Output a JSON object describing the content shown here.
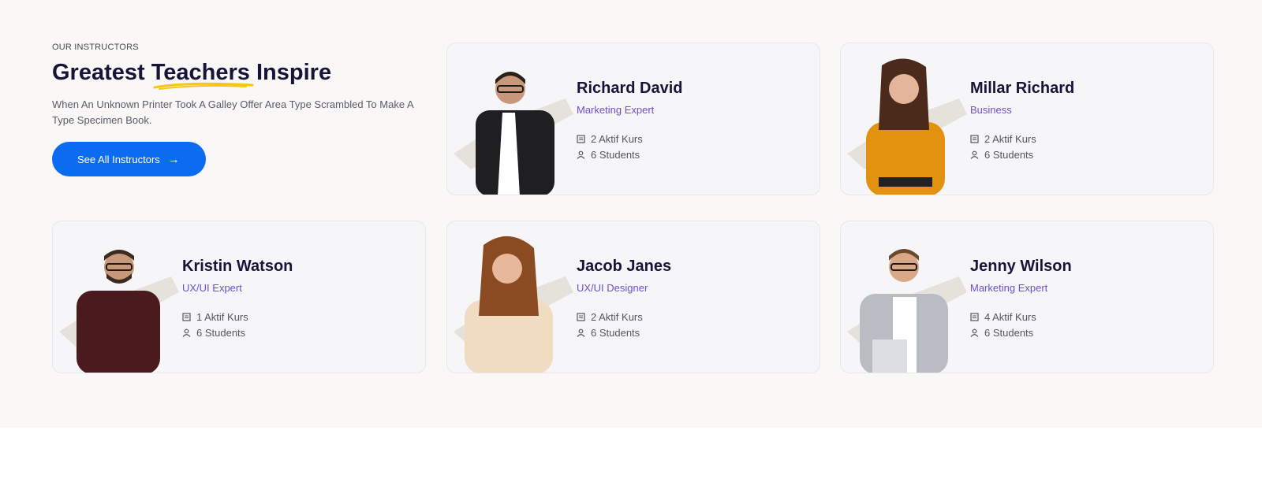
{
  "section": {
    "eyebrow": "OUR INSTRUCTORS",
    "title": "Greatest Teachers Inspire",
    "description": "When An Unknown Printer Took A Galley Offer Area Type Scrambled To Make A Type Specimen Book.",
    "button_label": "See All Instructors",
    "button_icon": "arrow-right-icon"
  },
  "colors": {
    "section_bg": "#f9f8f6",
    "heading": "#161439",
    "role_text": "#6a4fd0",
    "button_bg": "#0b6cf2",
    "underline_accent": "#f5c518"
  },
  "instructors": [
    {
      "name": "Richard David",
      "role": "Marketing Expert",
      "courses": "2 Aktif Kurs",
      "students": "6 Students"
    },
    {
      "name": "Millar Richard",
      "role": "Business",
      "courses": "2 Aktif Kurs",
      "students": "6 Students"
    },
    {
      "name": "Kristin Watson",
      "role": "UX/UI Expert",
      "courses": "1 Aktif Kurs",
      "students": "6 Students"
    },
    {
      "name": "Jacob Janes",
      "role": "UX/UI Designer",
      "courses": "2 Aktif Kurs",
      "students": "6 Students"
    },
    {
      "name": "Jenny Wilson",
      "role": "Marketing Expert",
      "courses": "4 Aktif Kurs",
      "students": "6 Students"
    }
  ],
  "icons": {
    "courses": "book-icon",
    "students": "user-icon"
  }
}
